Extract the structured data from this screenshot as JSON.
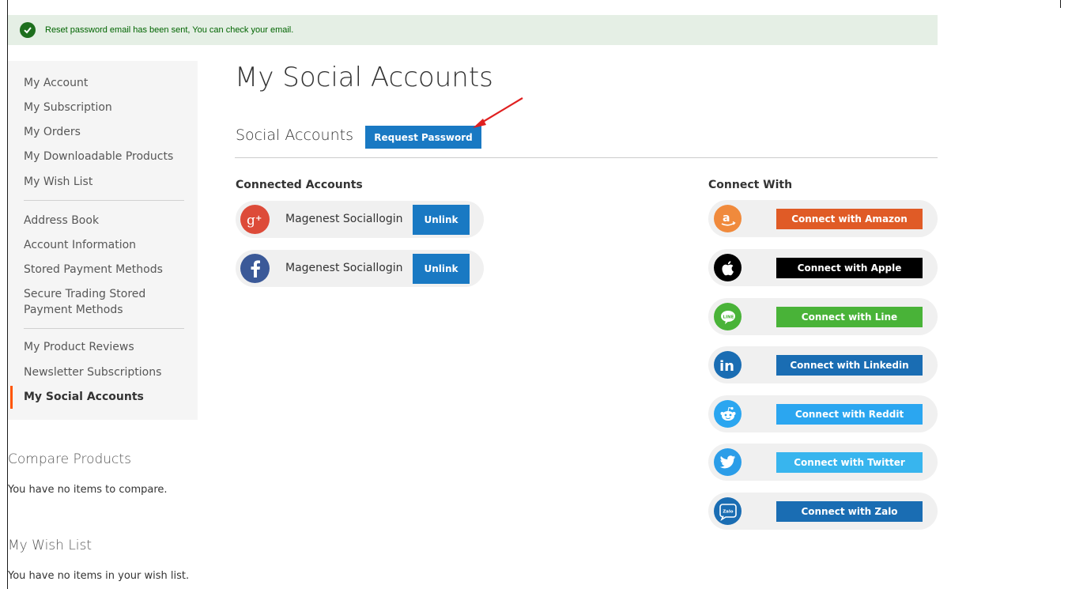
{
  "message": {
    "text": "Reset password email has been sent, You can check your email."
  },
  "sidebar": {
    "items": [
      {
        "label": "My Account"
      },
      {
        "label": "My Subscription"
      },
      {
        "label": "My Orders"
      },
      {
        "label": "My Downloadable Products"
      },
      {
        "label": "My Wish List"
      },
      {
        "label": "Address Book"
      },
      {
        "label": "Account Information"
      },
      {
        "label": "Stored Payment Methods"
      },
      {
        "label": "Secure Trading Stored Payment Methods"
      },
      {
        "label": "My Product Reviews"
      },
      {
        "label": "Newsletter Subscriptions"
      },
      {
        "label": "My Social Accounts"
      }
    ]
  },
  "compare": {
    "title": "Compare Products",
    "empty": "You have no items to compare."
  },
  "wishlist": {
    "title": "My Wish List",
    "empty": "You have no items in your wish list."
  },
  "page": {
    "title": "My Social Accounts",
    "section_title": "Social Accounts",
    "request_password_label": "Request Password"
  },
  "connected": {
    "title": "Connected Accounts",
    "accounts": [
      {
        "icon": "google-plus-icon",
        "name": "Magenest Sociallogin",
        "action": "Unlink",
        "color": "#dd4b39"
      },
      {
        "icon": "facebook-icon",
        "name": "Magenest Sociallogin",
        "action": "Unlink",
        "color": "#3b5998"
      }
    ]
  },
  "connect_with": {
    "title": "Connect With",
    "providers": [
      {
        "icon": "amazon-icon",
        "label": "Connect with Amazon",
        "color": "#e05b26",
        "icon_color": "#f08a3c"
      },
      {
        "icon": "apple-icon",
        "label": "Connect with Apple",
        "color": "#000000",
        "icon_color": "#000000"
      },
      {
        "icon": "line-icon",
        "label": "Connect with Line",
        "color": "#49b338",
        "icon_color": "#49b338"
      },
      {
        "icon": "linkedin-icon",
        "label": "Connect with Linkedin",
        "color": "#1a6db3",
        "icon_color": "#1a6db3"
      },
      {
        "icon": "reddit-icon",
        "label": "Connect with Reddit",
        "color": "#2ba6f0",
        "icon_color": "#2ba6f0"
      },
      {
        "icon": "twitter-icon",
        "label": "Connect with Twitter",
        "color": "#38b5ee",
        "icon_color": "#2b9de8"
      },
      {
        "icon": "zalo-icon",
        "label": "Connect with Zalo",
        "color": "#1a6db3",
        "icon_color": "#1a6db3"
      }
    ]
  }
}
